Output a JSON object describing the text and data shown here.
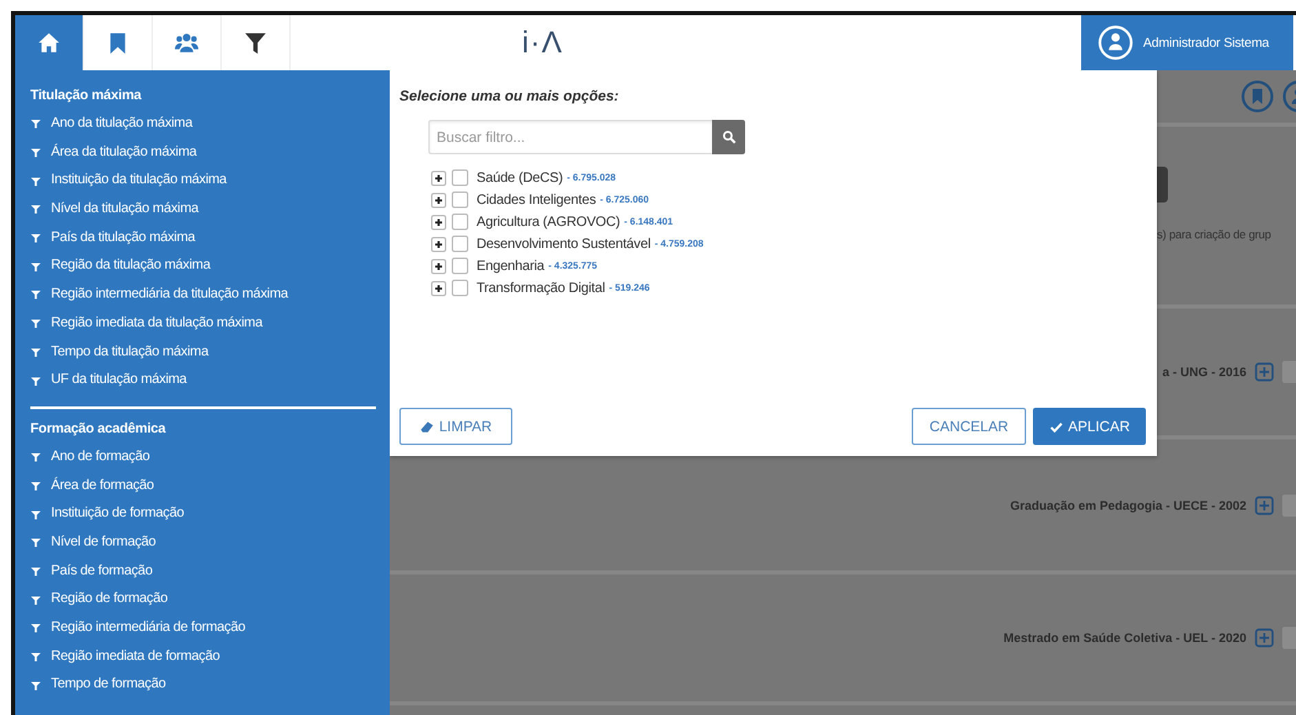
{
  "header": {
    "tabs": [
      {
        "kind": "home",
        "selected": true
      },
      {
        "kind": "bookmark",
        "selected": false
      },
      {
        "kind": "people",
        "selected": false
      },
      {
        "kind": "filter",
        "selected": false
      }
    ],
    "logo": "i·Λ",
    "user": {
      "name": "Administrador Sistema"
    }
  },
  "sidebar": {
    "sections": [
      {
        "title": "Titulação máxima",
        "items": [
          "Ano da titulação máxima",
          "Área da titulação máxima",
          "Instituição da titulação máxima",
          "Nível da titulação máxima",
          "País da titulação máxima",
          "Região da titulação máxima",
          "Região intermediária da titulação máxima",
          "Região imediata da titulação máxima",
          "Tempo da titulação máxima",
          "UF da titulação máxima"
        ]
      },
      {
        "title": "Formação acadêmica",
        "items": [
          "Ano de formação",
          "Área de formação",
          "Instituição de formação",
          "Nível de formação",
          "País de formação",
          "Região de formação",
          "Região intermediária de formação",
          "Região imediata de formação",
          "Tempo de formação"
        ]
      }
    ]
  },
  "background": {
    "note": "s) para criação de grup",
    "rows": [
      {
        "label": "a - UNG - 2016"
      },
      {
        "label": "Graduação em Pedagogia - UECE - 2002"
      },
      {
        "label": "Mestrado em Saúde Coletiva - UEL - 2020"
      }
    ]
  },
  "modal": {
    "prompt": "Selecione uma ou mais opções:",
    "search": {
      "placeholder": "Buscar filtro..."
    },
    "tree": [
      {
        "label": "Saúde (DeCS)",
        "count": "- 6.795.028",
        "checked": false,
        "expanded": false
      },
      {
        "label": "Cidades Inteligentes",
        "count": "- 6.725.060",
        "checked": false,
        "expanded": false
      },
      {
        "label": "Agricultura (AGROVOC)",
        "count": "- 6.148.401",
        "checked": false,
        "expanded": false
      },
      {
        "label": "Desenvolvimento Sustentável",
        "count": "- 4.759.208",
        "checked": false,
        "expanded": false
      },
      {
        "label": "Engenharia",
        "count": "- 4.325.775",
        "checked": false,
        "expanded": false
      },
      {
        "label": "Transformação Digital",
        "count": "- 519.246",
        "checked": false,
        "expanded": false
      }
    ],
    "buttons": {
      "clear": "LIMPAR",
      "cancel": "CANCELAR",
      "apply": "APLICAR"
    }
  }
}
